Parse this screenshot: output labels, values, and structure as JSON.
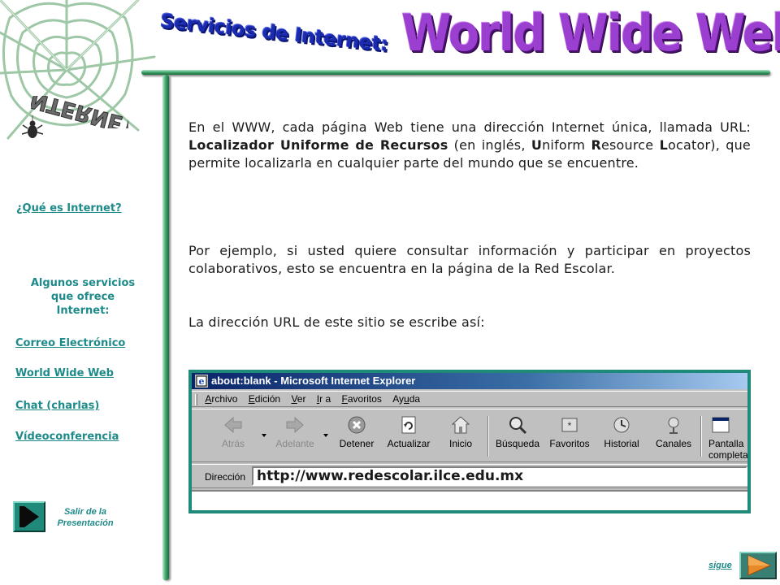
{
  "header": {
    "subtitle": "Servicios de Internet:",
    "title": "World Wide Web",
    "logo_text": "INTERNET"
  },
  "sidebar": {
    "what_is_link": "¿Qué es Internet?",
    "section_heading": [
      "Algunos servicios",
      "que ofrece",
      "Internet:"
    ],
    "links": [
      "Correo Electrónico",
      "World Wide Web",
      "Chat (charlas)",
      "Vídeoconferencia"
    ],
    "exit_label": [
      "Salir de la",
      "Presentación"
    ]
  },
  "content": {
    "p1": {
      "before_bold": "En el WWW, cada página Web tiene una dirección Internet única, llamada URL: ",
      "bold": "Localizador Uniforme de Recursos",
      "after_bold": " (en inglés, ",
      "u_letter": "U",
      "u_rest": "niform ",
      "r_letter": "R",
      "r_rest": "esource ",
      "l_letter": "L",
      "l_rest": "ocator),  que permite localizarla en cualquier parte del mundo que se encuentre."
    },
    "p2": "Por ejemplo, si usted quiere consultar información y participar en proyectos colaborativos, esto  se encuentra en la página de la Red Escolar.",
    "p3": "La dirección URL de este sitio se escribe así:"
  },
  "browser": {
    "window_title": "about:blank - Microsoft Internet Explorer",
    "menu": [
      "Archivo",
      "Edición",
      "Ver",
      "Ir a",
      "Favoritos",
      "Ayuda"
    ],
    "toolbar": [
      {
        "label": "Atrás",
        "icon": "back-arrow-icon",
        "enabled": false
      },
      {
        "label": "Adelante",
        "icon": "forward-arrow-icon",
        "enabled": false
      },
      {
        "label": "Detener",
        "icon": "stop-icon",
        "enabled": true
      },
      {
        "label": "Actualizar",
        "icon": "refresh-icon",
        "enabled": true
      },
      {
        "label": "Inicio",
        "icon": "home-icon",
        "enabled": true
      },
      {
        "label": "Búsqueda",
        "icon": "search-icon",
        "enabled": true
      },
      {
        "label": "Favoritos",
        "icon": "favorites-icon",
        "enabled": true
      },
      {
        "label": "Historial",
        "icon": "history-icon",
        "enabled": true
      },
      {
        "label": "Canales",
        "icon": "channels-icon",
        "enabled": true
      },
      {
        "label": "Pantalla\ncompleta",
        "icon": "fullscreen-icon",
        "enabled": true
      }
    ],
    "address_label": "Dirección",
    "address_value": "http://www.redescolar.ilce.edu.mx"
  },
  "footer": {
    "next_label": "sigue"
  },
  "colors": {
    "nav_link": "#1f8a8a",
    "title_purple": "#9b3fd0",
    "subtitle_blue": "#1a2bb0",
    "frame_green": "#3da66a"
  }
}
